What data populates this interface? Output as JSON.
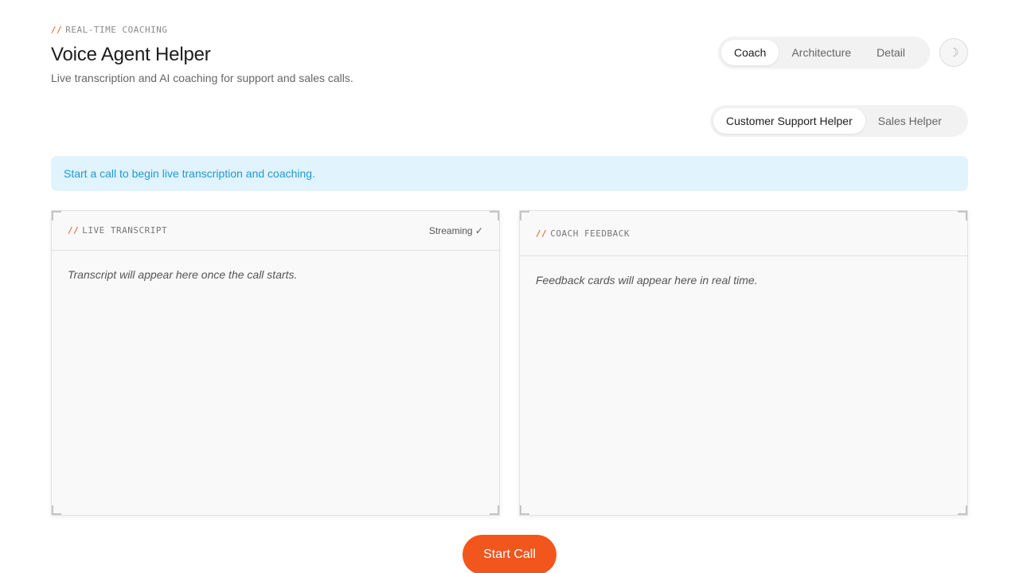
{
  "header": {
    "eyebrow_prefix": "//",
    "eyebrow": "REAL-TIME COACHING",
    "title": "Voice Agent Helper",
    "subtitle": "Live transcription and AI coaching for support and sales calls."
  },
  "nav": {
    "tabs": [
      {
        "label": "Coach",
        "active": true
      },
      {
        "label": "Architecture",
        "active": false
      },
      {
        "label": "Detail",
        "active": false
      }
    ],
    "theme_toggle_icon": "☽"
  },
  "helper_tabs": [
    {
      "label": "Customer Support Helper",
      "active": true
    },
    {
      "label": "Sales Helper",
      "active": false
    }
  ],
  "banner": {
    "text": "Start a call to begin live transcription and coaching."
  },
  "transcript_panel": {
    "prefix": "//",
    "label": "LIVE TRANSCRIPT",
    "status": "Streaming ✓",
    "placeholder": "Transcript will appear here once the call starts."
  },
  "feedback_panel": {
    "prefix": "//",
    "label": "COACH FEEDBACK",
    "placeholder": "Feedback cards will appear here in real time."
  },
  "actions": {
    "start_call": "Start Call"
  },
  "colors": {
    "accent": "#f2561d",
    "banner_bg": "#e1f3fd",
    "banner_text": "#1b9bd6"
  }
}
